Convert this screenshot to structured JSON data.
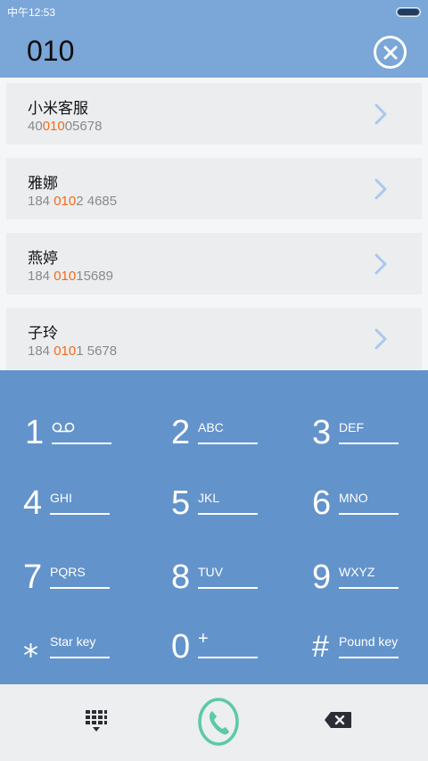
{
  "status_bar": {
    "time": "中午12:53"
  },
  "dialer": {
    "input": "010"
  },
  "results": [
    {
      "name": "小米客服",
      "num_pre": "40",
      "num_match": "010",
      "num_post": "05678"
    },
    {
      "name": "雅娜",
      "num_pre": "184 ",
      "num_match": "010",
      "num_post": "2 4685"
    },
    {
      "name": "燕婷",
      "num_pre": "184 ",
      "num_match": "010",
      "num_post": "15689"
    },
    {
      "name": "子玲",
      "num_pre": "184 ",
      "num_match": "010",
      "num_post": "1 5678"
    }
  ],
  "keys": [
    {
      "digit": "1",
      "letters": "",
      "icon": "voicemail-icon"
    },
    {
      "digit": "2",
      "letters": "ABC"
    },
    {
      "digit": "3",
      "letters": "DEF"
    },
    {
      "digit": "4",
      "letters": "GHI"
    },
    {
      "digit": "5",
      "letters": "JKL"
    },
    {
      "digit": "6",
      "letters": "MNO"
    },
    {
      "digit": "7",
      "letters": "PQRS"
    },
    {
      "digit": "8",
      "letters": "TUV"
    },
    {
      "digit": "9",
      "letters": "WXYZ"
    },
    {
      "digit": "⁎",
      "letters": "Star key"
    },
    {
      "digit": "0",
      "letters": "+"
    },
    {
      "digit": "#",
      "letters": "Pound key"
    }
  ],
  "icons": {
    "clear": "close-circle-icon",
    "keypad": "keypad-icon",
    "call": "call-icon",
    "backspace": "backspace-icon"
  },
  "colors": {
    "header": "#7aa6d8",
    "keypad": "#6393cb",
    "highlight": "#f26b1d",
    "call": "#5cc9a7",
    "chevron": "#a9c8ee"
  }
}
